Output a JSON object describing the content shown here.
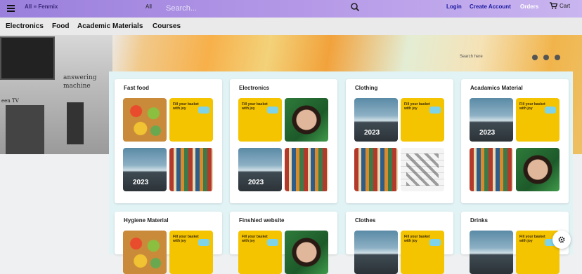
{
  "topbar": {
    "brand": "All ≡ Fenmix",
    "category": "All",
    "search_placeholder": "Search...",
    "login": "Login",
    "create_account": "Create Account",
    "orders": "Orders",
    "cart": "Cart"
  },
  "categories": [
    "Electronics",
    "Food",
    "Academic Materials",
    "Courses"
  ],
  "hero": {
    "search_placeholder": "Search here",
    "machine_label": "answering\nmachine",
    "tv_label": "een TV"
  },
  "ad": {
    "text": "Fill your basket\nwith joy"
  },
  "road_year": "2023",
  "cards": [
    {
      "title": "Fast food"
    },
    {
      "title": "Electronics"
    },
    {
      "title": "Clothing"
    },
    {
      "title": "Acadamics Material"
    },
    {
      "title": "Hygiene Material"
    },
    {
      "title": "Finshied website"
    },
    {
      "title": "Clothes"
    },
    {
      "title": "Drinks"
    }
  ],
  "colors": {
    "topbar_start": "#9a7fdc",
    "topbar_end": "#c9b5ef",
    "link": "#1a1aa0",
    "ad_yellow": "#f5c400",
    "panel": "#e2f3f6"
  }
}
